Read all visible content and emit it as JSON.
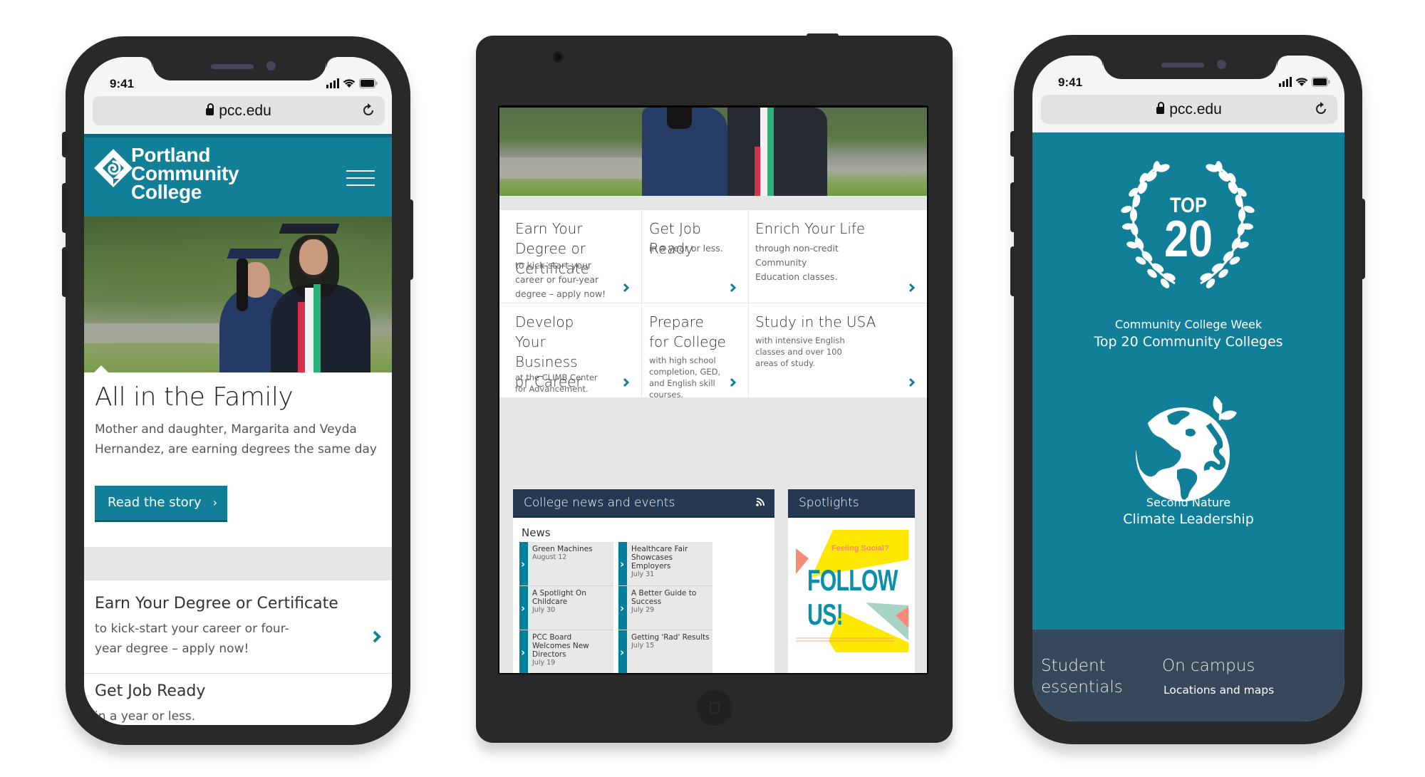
{
  "devices": {
    "left_phone": {
      "status_bar": {
        "time": "9:41"
      },
      "browser": {
        "url": "pcc.edu",
        "lock_icon": "lock-icon",
        "reload_icon": "reload-icon"
      },
      "header": {
        "logo_lines": [
          "Portland",
          "Community",
          "College"
        ],
        "menu_icon": "hamburger-icon"
      },
      "hero": {
        "image_alt": "Mother and daughter in graduation caps and gowns",
        "title": "All in the Family",
        "description": "Mother and daughter, Margarita and Veyda Hernandez, are earning degrees the same day",
        "cta_label": "Read the story",
        "cta_icon": "›"
      },
      "tiles": [
        {
          "title": "Earn Your Degree or Certificate",
          "description": "to kick-start your career or four-year degree – apply now!"
        },
        {
          "title": "Get Job Ready",
          "description": "in a year or less."
        }
      ]
    },
    "tablet": {
      "hero": {
        "image_alt": "Graduates in caps and gowns"
      },
      "tiles": [
        {
          "title": "Earn Your Degree or Certificate",
          "description": "to kick-start your career or four-year degree – apply now!"
        },
        {
          "title": "Get Job Ready",
          "description": "in a year or less."
        },
        {
          "title": "Enrich Your Life",
          "description": "through non-credit Community Education classes."
        },
        {
          "title": "Develop Your Business or Career",
          "description": "at the CLIMB Center for Advancement."
        },
        {
          "title": "Prepare for College",
          "description": "with high school completion, GED, and English skill courses."
        },
        {
          "title": "Study in the USA",
          "description": "with intensive English classes and over 100 areas of study."
        }
      ],
      "news_panel": {
        "heading": "College news and events",
        "rss_icon": "rss-icon",
        "section_label": "News",
        "items": [
          {
            "title": "Green Machines",
            "date": "August 12"
          },
          {
            "title": "Healthcare Fair Showcases Employers",
            "date": "July 31"
          },
          {
            "title": "A Spotlight On Childcare",
            "date": "July 30"
          },
          {
            "title": "A Better Guide to Success",
            "date": "July 29"
          },
          {
            "title": "PCC Board Welcomes New Directors",
            "date": "July 19"
          },
          {
            "title": "Getting 'Rad' Results",
            "date": "July 15"
          }
        ]
      },
      "spotlight_panel": {
        "heading": "Spotlights",
        "graphic": {
          "tagline": "Feeling Social?",
          "headline_line1": "FOLLOW",
          "headline_line2": "US!"
        }
      }
    },
    "right_phone": {
      "status_bar": {
        "time": "9:41"
      },
      "browser": {
        "url": "pcc.edu"
      },
      "awards": [
        {
          "badge_top": "TOP",
          "badge_number": "20",
          "source": "Community College Week",
          "title": "Top 20 Community Colleges"
        },
        {
          "icon": "earth-sprout-icon",
          "source": "Second Nature",
          "title": "Climate Leadership"
        }
      ],
      "footer_links": [
        {
          "title": "Student essentials"
        },
        {
          "title": "On campus",
          "subtitle": "Locations and maps"
        }
      ]
    }
  },
  "colors": {
    "brand_teal": "#117f97",
    "navy": "#253a52",
    "slate": "#37485a",
    "device_frame": "#282928",
    "spot_yellow": "#ffe800",
    "spot_coral": "#f98b76",
    "spot_mint": "#a8d3c4"
  }
}
